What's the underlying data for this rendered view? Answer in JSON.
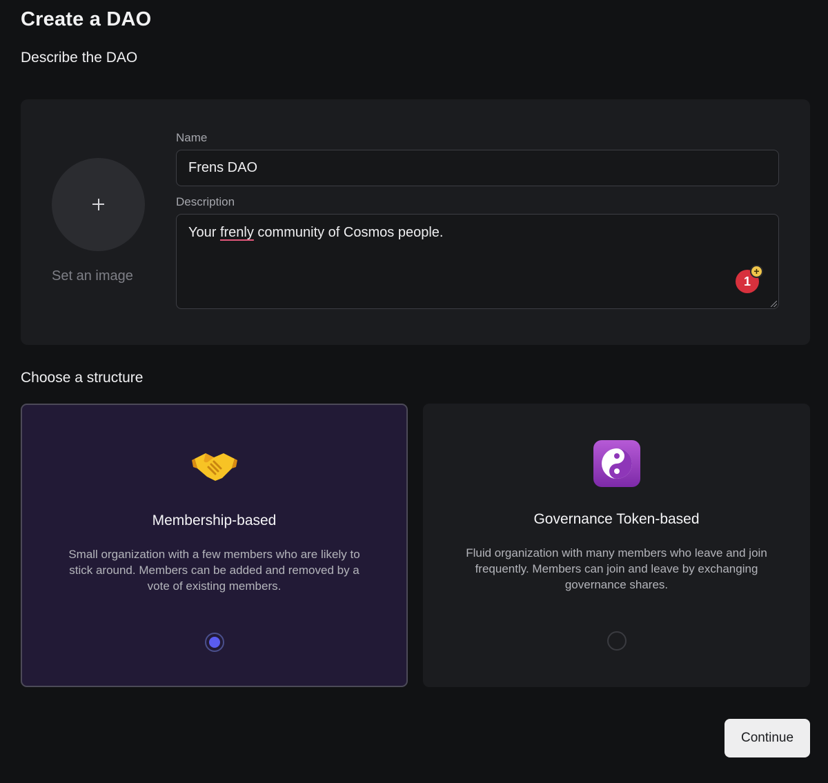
{
  "header": {
    "title": "Create a DAO"
  },
  "describe": {
    "section_title": "Describe the DAO",
    "image_label": "Set an image",
    "name_label": "Name",
    "name_value": "Frens DAO",
    "description_label": "Description",
    "description_value": {
      "before": "Your ",
      "misspelled": "frenly",
      "after": " community of Cosmos people."
    },
    "grammar_badge_count": "1",
    "grammar_badge_plus": "+"
  },
  "structure": {
    "section_title": "Choose a structure",
    "options": [
      {
        "icon": "handshake-icon",
        "title": "Membership-based",
        "description": "Small organization with a few members who are likely to stick around. Members can be added and removed by a vote of existing members.",
        "selected": true
      },
      {
        "icon": "yin-yang-icon",
        "title": "Governance Token-based",
        "description": "Fluid organization with many members who leave and join frequently. Members can join and leave by exchanging governance shares.",
        "selected": false
      }
    ]
  },
  "actions": {
    "continue_label": "Continue"
  },
  "colors": {
    "background": "#111214",
    "card": "#1b1c1f",
    "selected_card": "#221a36",
    "radio_accent": "#5a5cf0",
    "grammar_badge": "#d7313d"
  }
}
